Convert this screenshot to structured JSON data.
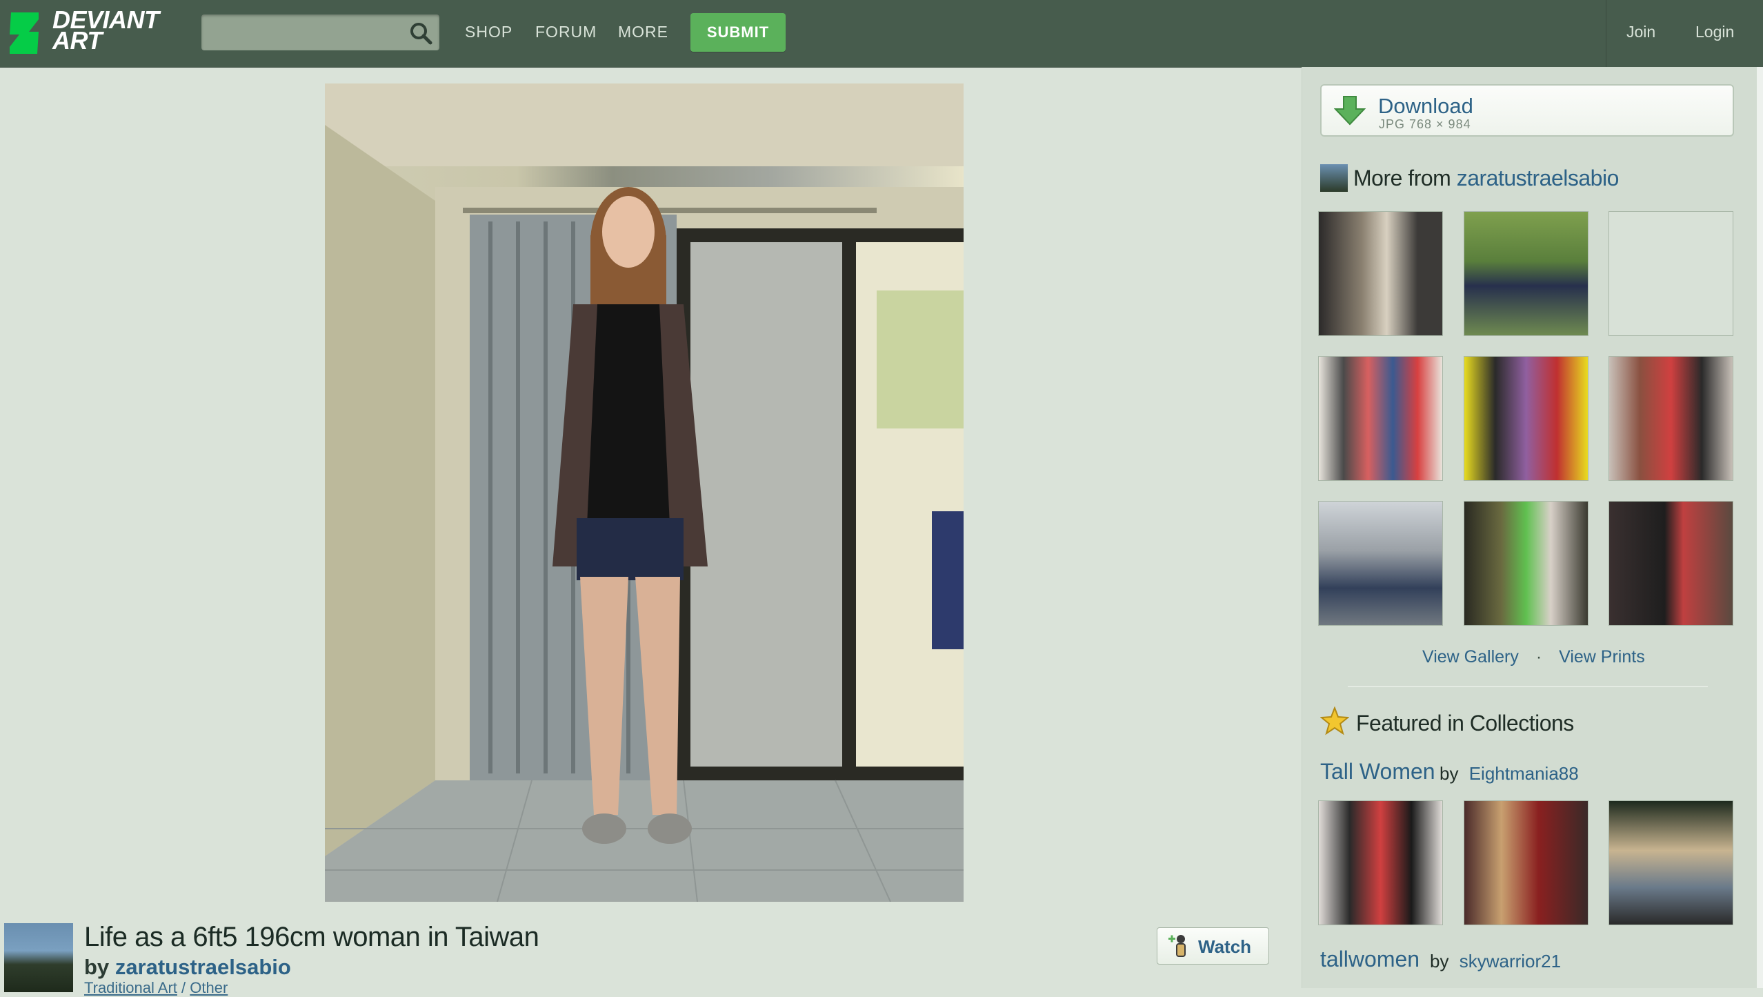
{
  "header": {
    "logo_line1": "DEVIANT",
    "logo_line2": "ART",
    "search_placeholder": "",
    "nav": [
      "SHOP",
      "FORUM",
      "MORE"
    ],
    "submit_label": "SUBMIT",
    "join_label": "Join",
    "login_label": "Login"
  },
  "deviation": {
    "title": "Life as a 6ft5 196cm woman in Taiwan",
    "by_prefix": "by",
    "author": "zaratustraelsabio",
    "category_1": "Traditional Art",
    "category_sep": "/",
    "category_2": "Other",
    "watch_label": "Watch"
  },
  "sidebar": {
    "download_label": "Download",
    "download_meta": "JPG 768 × 984",
    "more_from_prefix": "More from",
    "more_from_author": "zaratustraelsabio",
    "view_gallery": "View Gallery",
    "dot": "·",
    "view_prints": "View Prints",
    "featured_title": "Featured in Collections",
    "collections": [
      {
        "title": "Tall Women",
        "by": "by",
        "owner": "Eightmania88"
      },
      {
        "title": "tallwomen",
        "by": "by",
        "owner": "skywarrior21"
      }
    ]
  },
  "colors": {
    "topbar": "#475c4d",
    "page_bg": "#dae3d9",
    "sidebar_bg": "#d2dcd1",
    "link": "#2d6287",
    "submit": "#5bb15b"
  },
  "icons": [
    "deviantart-logo-icon",
    "search-icon",
    "download-arrow-icon",
    "avatar-icon",
    "star-icon",
    "watch-icon"
  ]
}
